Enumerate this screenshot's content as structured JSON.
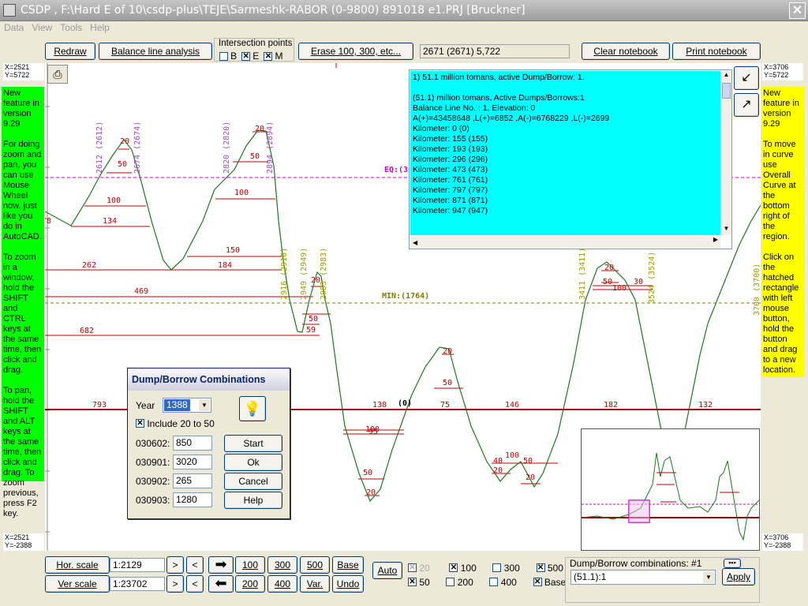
{
  "window": {
    "title": "CSDP , F:\\Hard E of 10\\csdp-plus\\TEJE\\Sarmeshk-RABOR (0-9800) 891018  e1.PRJ [Bruckner]"
  },
  "menu": [
    "Data",
    "View",
    "Tools",
    "Help"
  ],
  "toolbar": {
    "redraw": "Redraw",
    "balance": "Balance line analysis",
    "intersection_title": "Intersection points",
    "ip": [
      {
        "label": "B",
        "checked": false
      },
      {
        "label": "E",
        "checked": true
      },
      {
        "label": "M",
        "checked": true
      }
    ],
    "erase": "Erase 100, 300, etc...",
    "status": "2671 (2671)  5,722",
    "clear_notebook": "Clear notebook",
    "print_notebook": "Print notebook"
  },
  "coords": {
    "top_left": [
      "X=2521",
      "Y=5722"
    ],
    "top_right": [
      "X=3706",
      "Y=5722"
    ],
    "bottom_left": [
      "X=2521",
      "Y=-2388"
    ],
    "bottom_right": [
      "X=3706",
      "Y=-2388"
    ]
  },
  "notes": {
    "left": "New feature in version 9.29\n\nFor doing zoom and pan, you can use Mouse Wheel now, just like you do in AutoCAD.\n\nTo zoom in a window, hold the SHIFT and CTRL keys at the same time, then click and drag.\n\nTo pan, hold the SHIFT and ALT keys at the same time, then click and drag. To zoom previous, press F2 key.",
    "right": "New feature in version 9.29\n\nTo move in curve use Overall Curve at the bottom right of the region.\n\nClick on the hatched rectangle with left mouse button, hold the button and drag to a new location."
  },
  "notebook": {
    "lines": [
      "1) 51.1 million tomans, active Dump/Borrow: 1.",
      "",
      "(51.1) million tomans, Active Dumps/Borrows:1",
      "Balance Line No. : 1, Elevation: 0",
      "A(+)=43458648 ,L(+)=6852 ,A(-)=6768229 ,L(-)=2699",
      "Kilometer: 0 (0)",
      "Kilometer: 155 (155)",
      "Kilometer: 193 (193)",
      "Kilometer: 296 (296)",
      "Kilometer: 473 (473)",
      "Kilometer: 761 (761)",
      "Kilometer: 797 (797)",
      "Kilometer: 871 (871)",
      "Kilometer: 947 (947)"
    ]
  },
  "chart_labels": {
    "eq": "EQ:(30",
    "min": "MIN:(1764)",
    "chainages": [
      "2612 (2612)",
      "2674 (2674)",
      "2820 (2820)",
      "2894 (2894)",
      "2916 (2916)",
      "2949 (2949)",
      "2983 (2983)",
      "3411 (3411)",
      "3524 (3524)",
      "3700 (3700)"
    ],
    "hauls": [
      "8",
      "134",
      "100",
      "50",
      "20",
      "262",
      "184",
      "150",
      "469",
      "682",
      "100",
      "50",
      "20",
      "20",
      "50",
      "59",
      "793",
      "138",
      "(0)",
      "75",
      "146",
      "182",
      "132",
      "100",
      "95",
      "50",
      "20",
      "20",
      "50",
      "40",
      "20",
      "100",
      "50",
      "20",
      "20",
      "50",
      "100",
      "30"
    ]
  },
  "dialog": {
    "title": "Dump/Borrow Combinations",
    "year_label": "Year",
    "year_value": "1388",
    "include_label": "Include 20 to 50",
    "include_checked": true,
    "rows": [
      {
        "label": "030602:",
        "value": "850",
        "button": "Start"
      },
      {
        "label": "030901:",
        "value": "3020",
        "button": "Ok"
      },
      {
        "label": "030902:",
        "value": "265",
        "button": "Cancel"
      },
      {
        "label": "030903:",
        "value": "1280",
        "button": "Help"
      }
    ]
  },
  "bottom": {
    "hor_scale": "Hor. scale",
    "hor_value": "1:2129",
    "ver_scale": "Ver scale",
    "ver_value": "1:23702",
    "next": ">",
    "prev": "<",
    "b100": "100",
    "b300": "300",
    "b500": "500",
    "base": "Base",
    "b200": "200",
    "b400": "400",
    "var": "Var.",
    "undo": "Undo",
    "auto": "Auto",
    "checks": [
      {
        "label": "20",
        "checked": true,
        "disabled": true
      },
      {
        "label": "100",
        "checked": true
      },
      {
        "label": "300",
        "checked": false
      },
      {
        "label": "500",
        "checked": true
      },
      {
        "label": "50",
        "checked": true
      },
      {
        "label": "200",
        "checked": false
      },
      {
        "label": "400",
        "checked": false
      },
      {
        "label": "Base",
        "checked": true
      }
    ],
    "combo_title": "Dump/Borrow combinations: #1",
    "combo_value": "(51.1):1",
    "apply": "Apply"
  }
}
